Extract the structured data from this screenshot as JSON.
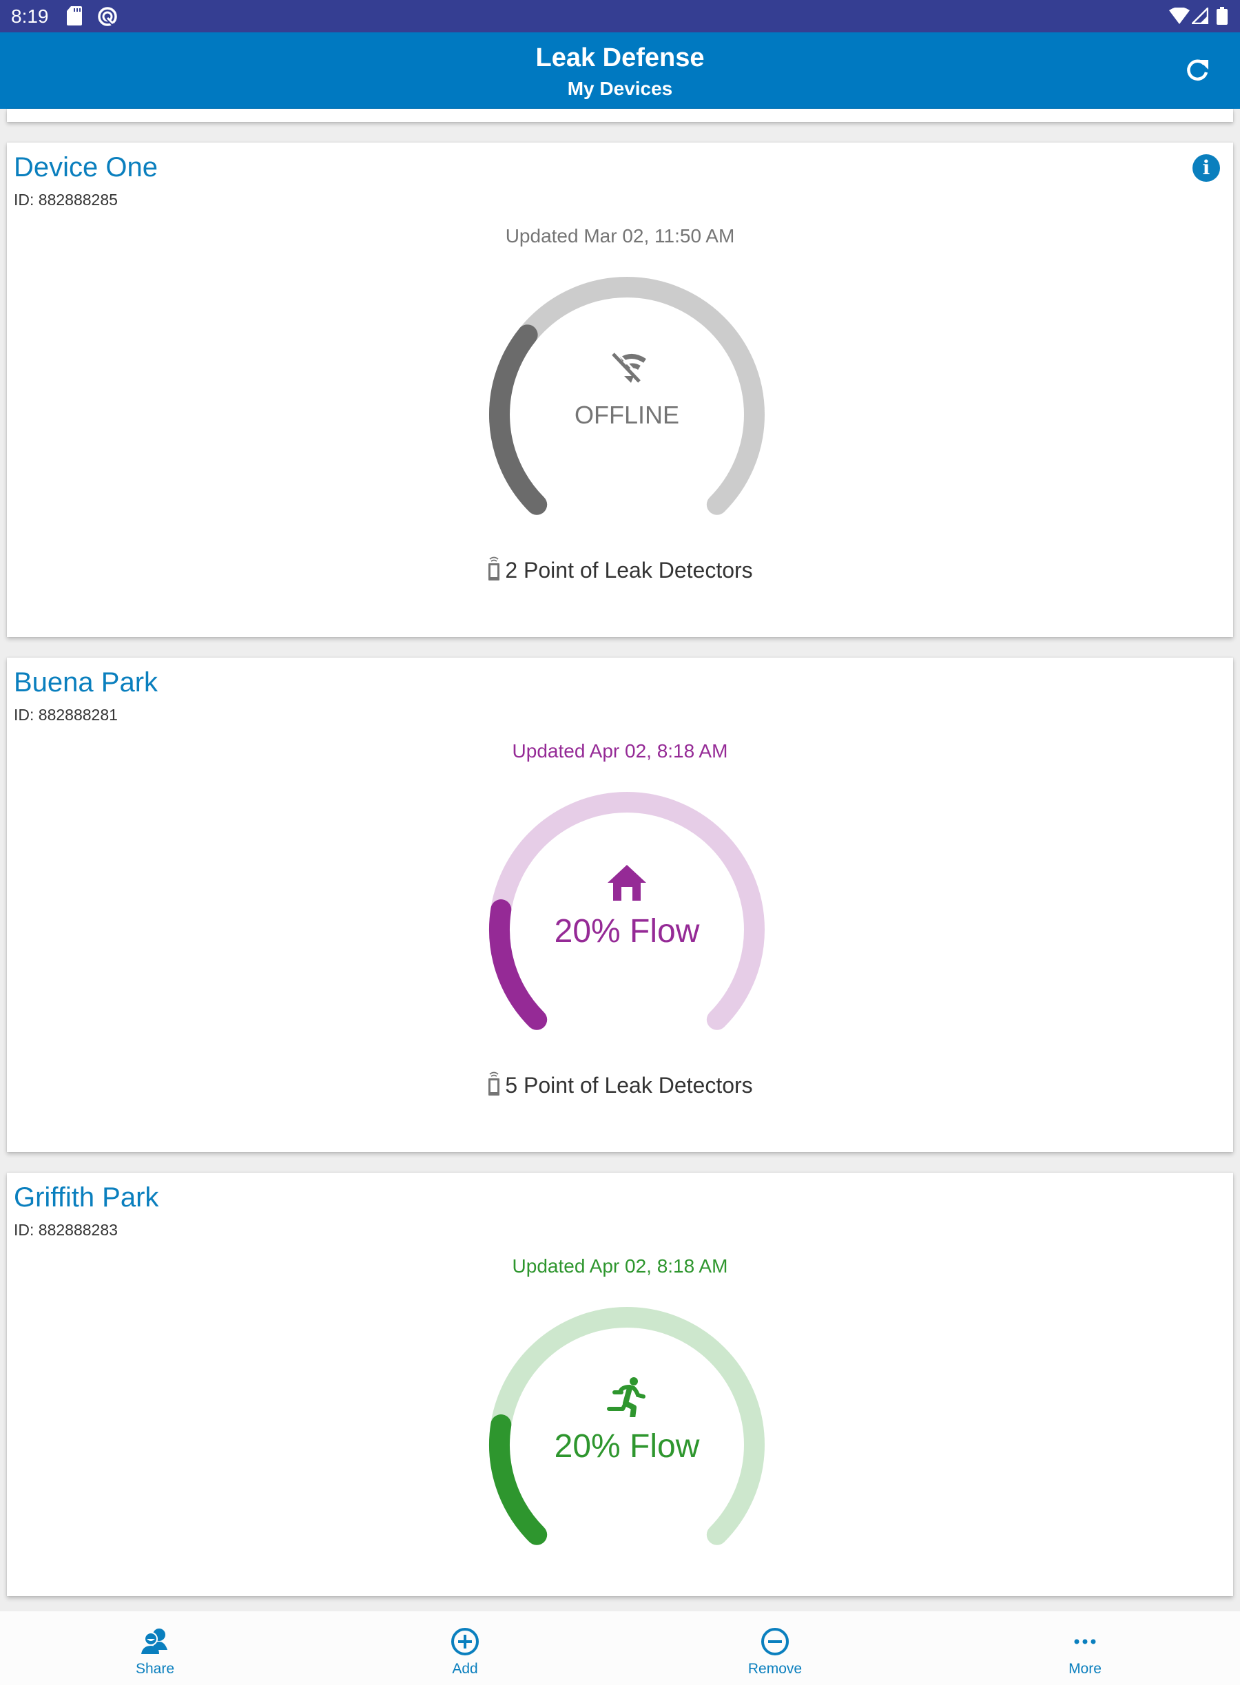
{
  "status_bar": {
    "time": "8:19",
    "left_icons": [
      "sd-card-icon",
      "data-saver-icon"
    ],
    "right_icons": [
      "wifi-icon",
      "cell-signal-icon",
      "battery-icon"
    ]
  },
  "header": {
    "title": "Leak Defense",
    "subtitle": "My Devices",
    "refresh_icon": "refresh-icon",
    "color": "#0079c1"
  },
  "devices": [
    {
      "name": "Device One",
      "id_label": "ID: 882888285",
      "updated": "Updated Mar 02, 11:50 AM",
      "status": "OFFLINE",
      "status_icon": "wifi-off-icon",
      "gauge_fraction": 0.31,
      "color": "#6b6b6b",
      "track_color": "#cccccc",
      "text_color": "#757575",
      "detectors": "2 Point of Leak Detectors",
      "has_info_button": true
    },
    {
      "name": "Buena Park",
      "id_label": "ID: 882888281",
      "updated": "Updated Apr 02, 8:18 AM",
      "status": "20% Flow",
      "status_icon": "home-icon",
      "gauge_fraction": 0.2,
      "color": "#952a96",
      "track_color": "#e6cde7",
      "text_color": "#952a96",
      "detectors": "5 Point of Leak Detectors",
      "has_info_button": false
    },
    {
      "name": "Griffith Park",
      "id_label": "ID: 882888283",
      "updated": "Updated Apr 02, 8:18 AM",
      "status": "20% Flow",
      "status_icon": "running-person-icon",
      "gauge_fraction": 0.2,
      "color": "#2e962e",
      "track_color": "#cde7cd",
      "text_color": "#2e962e",
      "detectors": "",
      "has_info_button": false
    }
  ],
  "bottom_nav": [
    {
      "label": "Share",
      "icon": "share-users-icon"
    },
    {
      "label": "Add",
      "icon": "add-circle-icon"
    },
    {
      "label": "Remove",
      "icon": "remove-circle-icon"
    },
    {
      "label": "More",
      "icon": "more-dots-icon"
    }
  ],
  "accent_color": "#0a7fbe"
}
